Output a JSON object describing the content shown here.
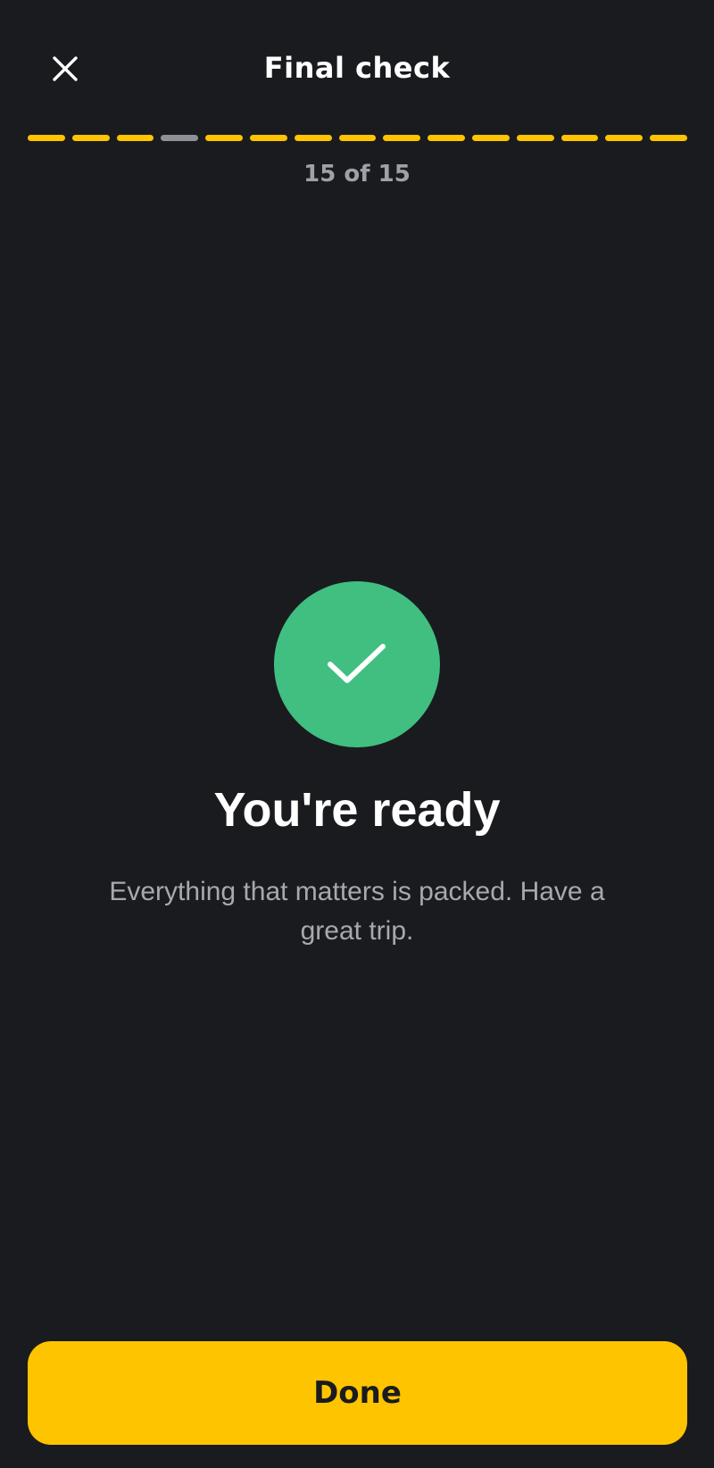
{
  "header": {
    "title": "Final check",
    "close_icon": "close-icon"
  },
  "progress": {
    "total_steps": 15,
    "current_step": 15,
    "label": "15 of 15",
    "segments": [
      {
        "state": "complete"
      },
      {
        "state": "complete"
      },
      {
        "state": "complete"
      },
      {
        "state": "incomplete"
      },
      {
        "state": "complete"
      },
      {
        "state": "complete"
      },
      {
        "state": "complete"
      },
      {
        "state": "complete"
      },
      {
        "state": "complete"
      },
      {
        "state": "complete"
      },
      {
        "state": "complete"
      },
      {
        "state": "complete"
      },
      {
        "state": "complete"
      },
      {
        "state": "complete"
      },
      {
        "state": "complete"
      }
    ]
  },
  "success": {
    "icon": "check-icon",
    "headline": "You're ready",
    "message": "Everything that matters is packed. Have a great trip."
  },
  "footer": {
    "done_label": "Done"
  },
  "colors": {
    "background": "#1a1b1f",
    "accent": "#ffc400",
    "segment_incomplete": "#8e9098",
    "success": "#40bf80",
    "muted_text": "#a7a9af"
  }
}
